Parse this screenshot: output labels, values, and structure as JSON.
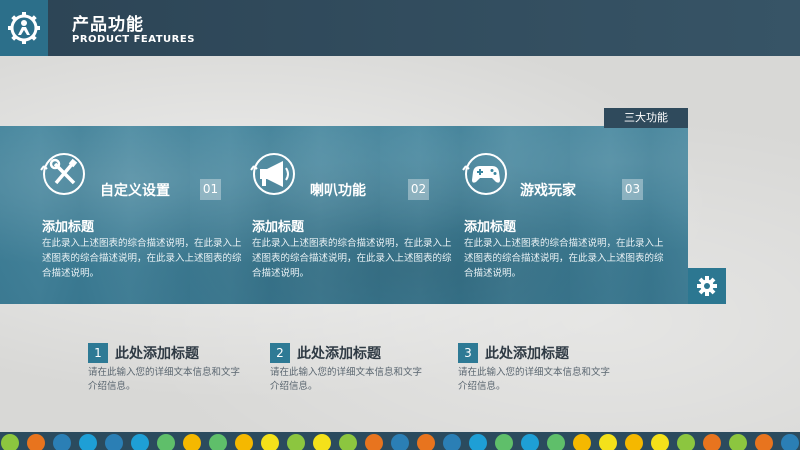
{
  "header": {
    "title_cn": "产品功能",
    "title_en": "PRODUCT FEATURES",
    "logo_icon": "gear-person-icon"
  },
  "tag": {
    "label": "三大功能"
  },
  "features": [
    {
      "name": "自定义设置",
      "num": "01",
      "icon": "tools-icon",
      "subtitle": "添加标题",
      "desc": "在此录入上述图表的综合描述说明，在此录入上述图表的综合描述说明，在此录入上述图表的综合描述说明。"
    },
    {
      "name": "喇叭功能",
      "num": "02",
      "icon": "megaphone-icon",
      "subtitle": "添加标题",
      "desc": "在此录入上述图表的综合描述说明，在此录入上述图表的综合描述说明，在此录入上述图表的综合描述说明。"
    },
    {
      "name": "游戏玩家",
      "num": "03",
      "icon": "gamepad-icon",
      "subtitle": "添加标题",
      "desc": "在此录入上述图表的综合描述说明，在此录入上述图表的综合描述说明，在此录入上述图表的综合描述说明。"
    }
  ],
  "items": [
    {
      "num": "1",
      "title": "此处添加标题",
      "desc": "请在此输入您的详细文本信息和文字介绍信息。"
    },
    {
      "num": "2",
      "title": "此处添加标题",
      "desc": "请在此输入您的详细文本信息和文字介绍信息。"
    },
    {
      "num": "3",
      "title": "此处添加标题",
      "desc": "请在此输入您的详细文本信息和文字介绍信息。"
    }
  ],
  "colors": {
    "header": "#2f4a5c",
    "accent": "#2e7a95",
    "dots": [
      "#8cc63f",
      "#f5b800",
      "#1e9fd6",
      "#e8741e",
      "#f4e11a",
      "#5fbf6a",
      "#2b7fb5"
    ]
  }
}
